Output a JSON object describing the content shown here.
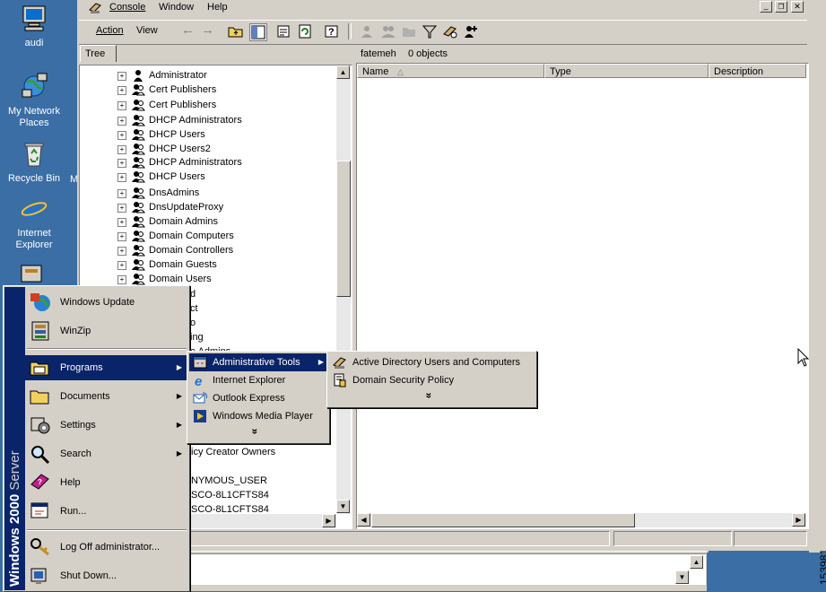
{
  "desktop": {
    "icons": [
      {
        "label": "audi",
        "icon": "computer-icon"
      },
      {
        "label": "My Network Places",
        "icon": "network-places-icon"
      },
      {
        "label": "Recycle Bin",
        "icon": "recycle-bin-icon"
      },
      {
        "label": "Internet Explorer",
        "icon": "internet-explorer-icon"
      }
    ],
    "partial_label": "M"
  },
  "menubar": {
    "items": [
      "Console",
      "Window",
      "Help"
    ]
  },
  "toolbar": {
    "action": "Action",
    "view": "View"
  },
  "tree_tab": "Tree",
  "right_pane": {
    "context": "fatemeh",
    "count": "0 objects"
  },
  "columns": [
    "Name",
    "Type",
    "Description"
  ],
  "tree_items": [
    "Administrator",
    "Cert Publishers",
    "Cert Publishers",
    "DHCP Administrators",
    "DHCP Users",
    "DHCP Users2",
    "DHCP Administrators",
    "DHCP Users",
    "DnsAdmins",
    "DnsUpdateProxy",
    "Domain Admins",
    "Domain Computers",
    "Domain Controllers",
    "Domain Guests",
    "Domain Users"
  ],
  "tree_partial": [
    "d",
    "ct",
    "o",
    "ing",
    "e Admins",
    "icy Creator Owners",
    "NYMOUS_USER",
    "SCO-8L1CFTS84",
    "SCO-8L1CFTS84"
  ],
  "start_menu": {
    "banner_bold": "Windows 2000",
    "banner_light": " Server",
    "top_items": [
      "Windows Update",
      "WinZip"
    ],
    "items": [
      "Programs",
      "Documents",
      "Settings",
      "Search",
      "Help",
      "Run...",
      "Log Off administrator...",
      "Shut Down..."
    ]
  },
  "programs_menu": {
    "items": [
      "Administrative Tools",
      "Internet Explorer",
      "Outlook Express",
      "Windows Media Player"
    ],
    "more": "»"
  },
  "admin_tools_menu": {
    "items": [
      "Active Directory Users and Computers",
      "Domain Security Policy"
    ],
    "more": "»"
  },
  "figure_id": "153981",
  "colors": {
    "desktop": "#3a6ea5",
    "face": "#d4d0c8",
    "highlight": "#0a246a",
    "banner": "#0a246a"
  }
}
